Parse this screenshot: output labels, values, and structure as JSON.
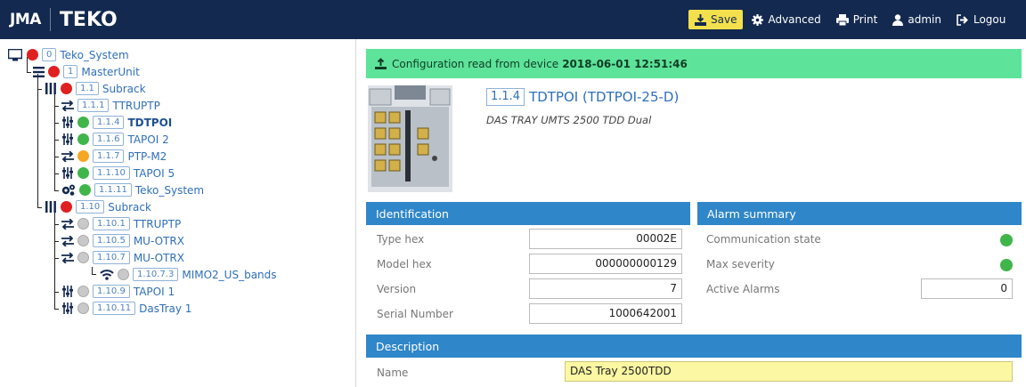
{
  "header": {
    "logo_jma": "JMA",
    "logo_teko": "TEKO",
    "nav": {
      "save": "Save",
      "advanced": "Advanced",
      "print": "Print",
      "user": "admin",
      "logout": "Logou"
    }
  },
  "tree": {
    "nodes": [
      {
        "id": "0",
        "label": "Teko_System",
        "status": "red",
        "icon": "monitor-icon"
      },
      {
        "id": "1",
        "label": "MasterUnit",
        "status": "red",
        "icon": "list-icon"
      },
      {
        "id": "1.1",
        "label": "Subrack",
        "status": "red",
        "icon": "subrack-icon"
      },
      {
        "id": "1.1.1",
        "label": "TTRUPTP",
        "status": "none",
        "icon": "arrows-icon"
      },
      {
        "id": "1.1.4",
        "label": "TDTPOI",
        "status": "green",
        "icon": "sliders-icon"
      },
      {
        "id": "1.1.6",
        "label": "TAPOI 2",
        "status": "green",
        "icon": "sliders-icon"
      },
      {
        "id": "1.1.7",
        "label": "PTP-M2",
        "status": "orange",
        "icon": "arrows-icon"
      },
      {
        "id": "1.1.10",
        "label": "TAPOI 5",
        "status": "green",
        "icon": "sliders-icon"
      },
      {
        "id": "1.1.11",
        "label": "Teko_System",
        "status": "green",
        "icon": "gears-icon"
      },
      {
        "id": "1.10",
        "label": "Subrack",
        "status": "red",
        "icon": "subrack-icon"
      },
      {
        "id": "1.10.1",
        "label": "TTRUPTP",
        "status": "grey",
        "icon": "arrows-icon"
      },
      {
        "id": "1.10.5",
        "label": "MU-OTRX",
        "status": "grey",
        "icon": "arrows-icon"
      },
      {
        "id": "1.10.7",
        "label": "MU-OTRX",
        "status": "grey",
        "icon": "arrows-icon"
      },
      {
        "id": "1.10.7.3",
        "label": "MIMO2_US_bands",
        "status": "grey",
        "icon": "wifi-icon"
      },
      {
        "id": "1.10.9",
        "label": "TAPOI 1",
        "status": "grey",
        "icon": "sliders-icon"
      },
      {
        "id": "1.10.11",
        "label": "DasTray 1",
        "status": "grey",
        "icon": "sliders-icon"
      }
    ]
  },
  "alert": {
    "text": "Configuration read from device",
    "timestamp": "2018-06-01 12:51:46"
  },
  "device": {
    "id": "1.1.4",
    "name": "TDTPOI (TDTPOI-25-D)",
    "description": "DAS TRAY UMTS 2500 TDD Dual"
  },
  "identification": {
    "title": "Identification",
    "fields": [
      {
        "label": "Type hex",
        "value": "00002E"
      },
      {
        "label": "Model hex",
        "value": "000000000129"
      },
      {
        "label": "Version",
        "value": "7"
      },
      {
        "label": "Serial Number",
        "value": "1000642001"
      }
    ]
  },
  "alarm_summary": {
    "title": "Alarm summary",
    "communication_state_label": "Communication state",
    "communication_state_color": "#3fb54a",
    "max_severity_label": "Max severity",
    "max_severity_color": "#3fb54a",
    "active_alarms_label": "Active Alarms",
    "active_alarms_value": "0"
  },
  "description": {
    "title": "Description",
    "name_label": "Name",
    "name_value": "DAS Tray 2500TDD"
  },
  "colors": {
    "topbar": "#13294f",
    "panel_header": "#2f86c8",
    "alert_bg": "#5ee39a",
    "save_bg": "#f4e04d",
    "status_red": "#e02020",
    "status_green": "#3fb54a",
    "status_orange": "#f5a623"
  }
}
